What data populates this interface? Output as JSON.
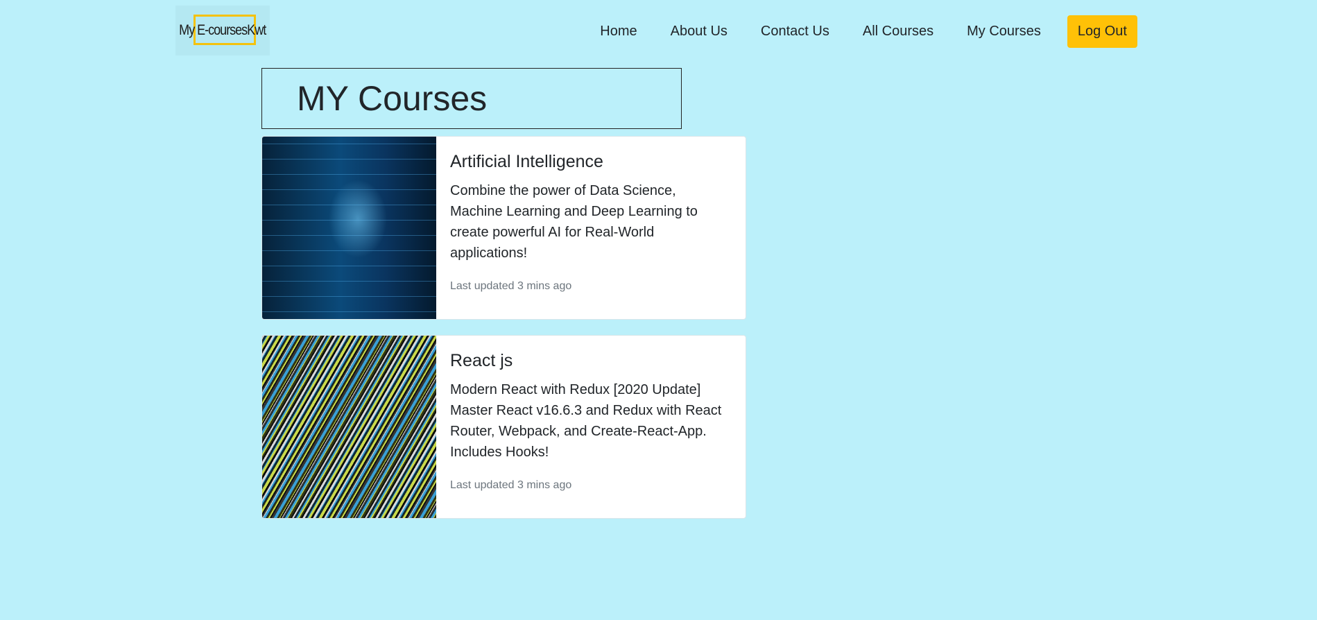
{
  "brand": {
    "logo_text": "My E-coursesKwt"
  },
  "nav": {
    "links": [
      "Home",
      "About Us",
      "Contact Us",
      "All Courses",
      "My Courses"
    ],
    "logout_label": "Log Out"
  },
  "main": {
    "title": "MY Courses",
    "courses": [
      {
        "title": "Artificial Intelligence",
        "description": "Combine the power of Data Science, Machine Learning and Deep Learning to create powerful AI for Real-World applications!",
        "updated": "Last updated 3 mins ago"
      },
      {
        "title": "React js",
        "description": "Modern React with Redux [2020 Update] Master React v16.6.3 and Redux with React Router, Webpack, and Create-React-App. Includes Hooks!",
        "updated": "Last updated 3 mins ago"
      }
    ]
  },
  "colors": {
    "background": "#bbf0fa",
    "accent": "#ffc107",
    "logo_border": "#f4c20d"
  }
}
